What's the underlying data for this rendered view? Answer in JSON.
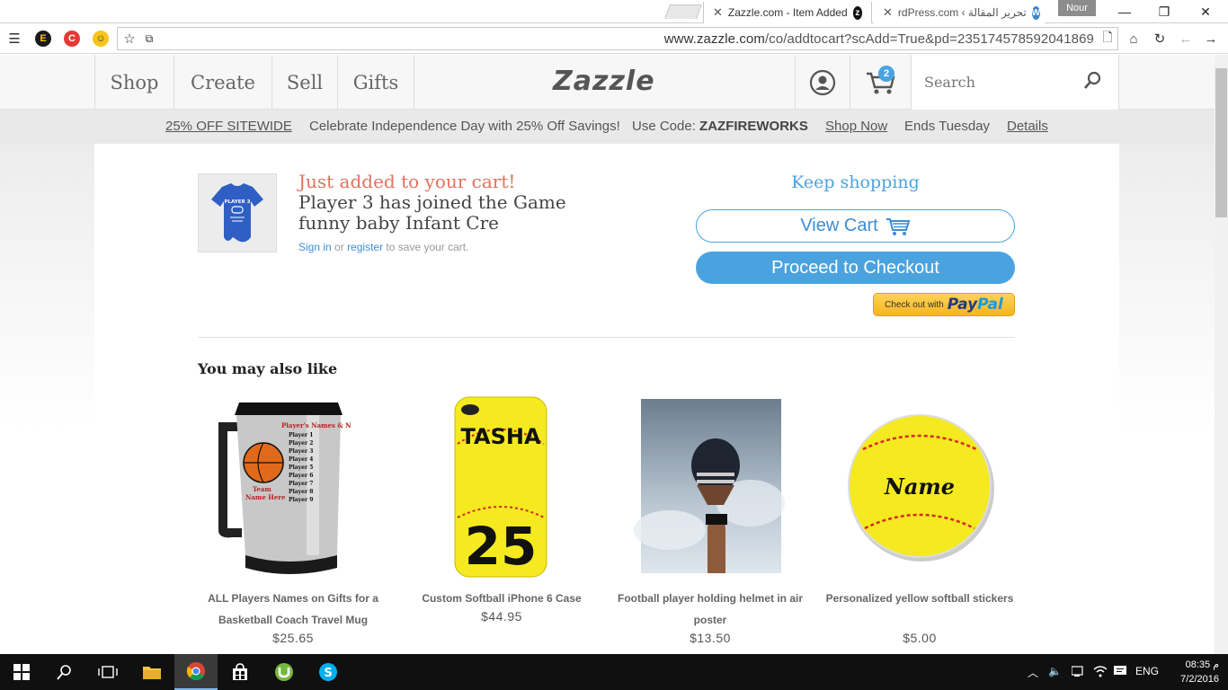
{
  "browser": {
    "tabs": [
      {
        "title": "Zazzle.com - Item Added",
        "active": true
      },
      {
        "title": "rdPress.com ‹ تحرير المقالة",
        "active": false
      }
    ],
    "profile_name": "Nour",
    "url_host": "www.zazzle.com",
    "url_path": "/co/addtocart?scAdd=True&pd=235174578592041869"
  },
  "header": {
    "nav": [
      "Shop",
      "Create",
      "Sell",
      "Gifts"
    ],
    "logo": "Zazzle",
    "cart_count": "2",
    "search_placeholder": "Search"
  },
  "promo": {
    "offer": "25% OFF SITEWIDE",
    "message": "Celebrate Independence Day with 25% Off Savings!",
    "code_label": "Use Code:",
    "code": "ZAZFIREWORKS",
    "shop_now": "Shop Now",
    "ends": "Ends Tuesday",
    "details": "Details"
  },
  "cart": {
    "added_heading": "Just added to your cart!",
    "item_title": "Player 3 has joined the Game funny baby Infant Cre",
    "signin": "Sign in",
    "or": "or",
    "register": "register",
    "save_text": "to save your cart.",
    "keep_shopping": "Keep shopping",
    "view_cart": "View Cart",
    "checkout": "Proceed to Checkout",
    "paypal_prefix": "Check out with",
    "paypal_brand_1": "Pay",
    "paypal_brand_2": "Pal",
    "thumb_text": "PLAYER 3"
  },
  "recommendations": {
    "heading": "You may also like",
    "products": [
      {
        "name": "ALL Players Names on Gifts for a Basketball Coach Travel Mug",
        "price": "$25.65",
        "image_text": "Player's Names & N"
      },
      {
        "name": "Custom Softball iPhone 6 Case",
        "price": "$44.95",
        "image_name": "TASHA",
        "image_number": "25"
      },
      {
        "name": "Football player holding helmet in air poster",
        "price": "$13.50"
      },
      {
        "name": "Personalized yellow softball stickers",
        "price": "$5.00",
        "image_name": "Name"
      }
    ]
  },
  "taskbar": {
    "language": "ENG",
    "time": "08:35 م",
    "date": "7/2/2016"
  },
  "colors": {
    "accent_blue": "#4aa3df",
    "added_orange": "#e2725b",
    "softball_yellow": "#f4ea1f"
  }
}
